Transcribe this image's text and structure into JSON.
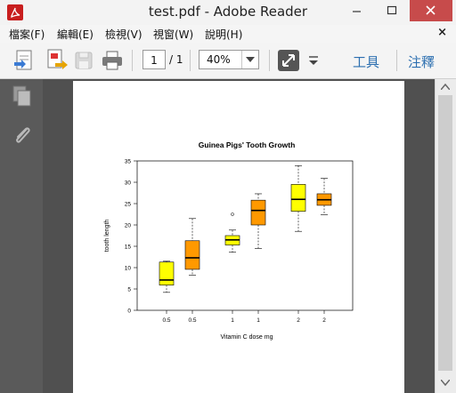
{
  "window": {
    "title": "test.pdf - Adobe Reader"
  },
  "menu": {
    "items": [
      "檔案(F)",
      "編輯(E)",
      "檢視(V)",
      "視窗(W)",
      "說明(H)"
    ],
    "close": "×"
  },
  "toolbar": {
    "page_current": "1",
    "page_total": "/ 1",
    "zoom": "40%",
    "tools_label": "工具",
    "comment_label": "注釋"
  },
  "icons": {
    "app": "adobe-reader-icon",
    "create": "create-pdf-icon",
    "export": "export-pdf-icon",
    "save": "save-icon",
    "print": "print-icon",
    "fit": "expand-icon",
    "pages": "pages-panel-icon",
    "attach": "paperclip-icon"
  },
  "colors": {
    "yellow_box": "#ffff00",
    "orange_box": "#ff9900",
    "close_btn": "#c74b4b",
    "link": "#2c6fb0"
  },
  "chart_data": {
    "type": "boxplot",
    "title": "Guinea Pigs' Tooth Growth",
    "xlabel": "Vitamin C dose mg",
    "ylabel": "tooth length",
    "ylim": [
      0,
      35
    ],
    "yticks": [
      0,
      5,
      10,
      15,
      20,
      25,
      30,
      35
    ],
    "categories": [
      "0.5",
      "0.5",
      "1",
      "1",
      "2",
      "2"
    ],
    "boxes": [
      {
        "label": "0.5",
        "color": "yellow",
        "min": 4.2,
        "q1": 5.9,
        "median": 7.1,
        "q3": 11.3,
        "max": 11.5,
        "outliers": []
      },
      {
        "label": "0.5",
        "color": "orange",
        "min": 8.2,
        "q1": 9.6,
        "median": 12.3,
        "q3": 16.3,
        "max": 21.5,
        "outliers": []
      },
      {
        "label": "1",
        "color": "yellow",
        "min": 13.6,
        "q1": 15.3,
        "median": 16.5,
        "q3": 17.5,
        "max": 18.8,
        "outliers": [
          22.5
        ]
      },
      {
        "label": "1",
        "color": "orange",
        "min": 14.5,
        "q1": 20.0,
        "median": 23.4,
        "q3": 25.8,
        "max": 27.3,
        "outliers": []
      },
      {
        "label": "2",
        "color": "yellow",
        "min": 18.5,
        "q1": 23.2,
        "median": 26.0,
        "q3": 29.5,
        "max": 33.9,
        "outliers": []
      },
      {
        "label": "2",
        "color": "orange",
        "min": 22.4,
        "q1": 24.6,
        "median": 25.9,
        "q3": 27.3,
        "max": 30.9,
        "outliers": []
      }
    ]
  }
}
